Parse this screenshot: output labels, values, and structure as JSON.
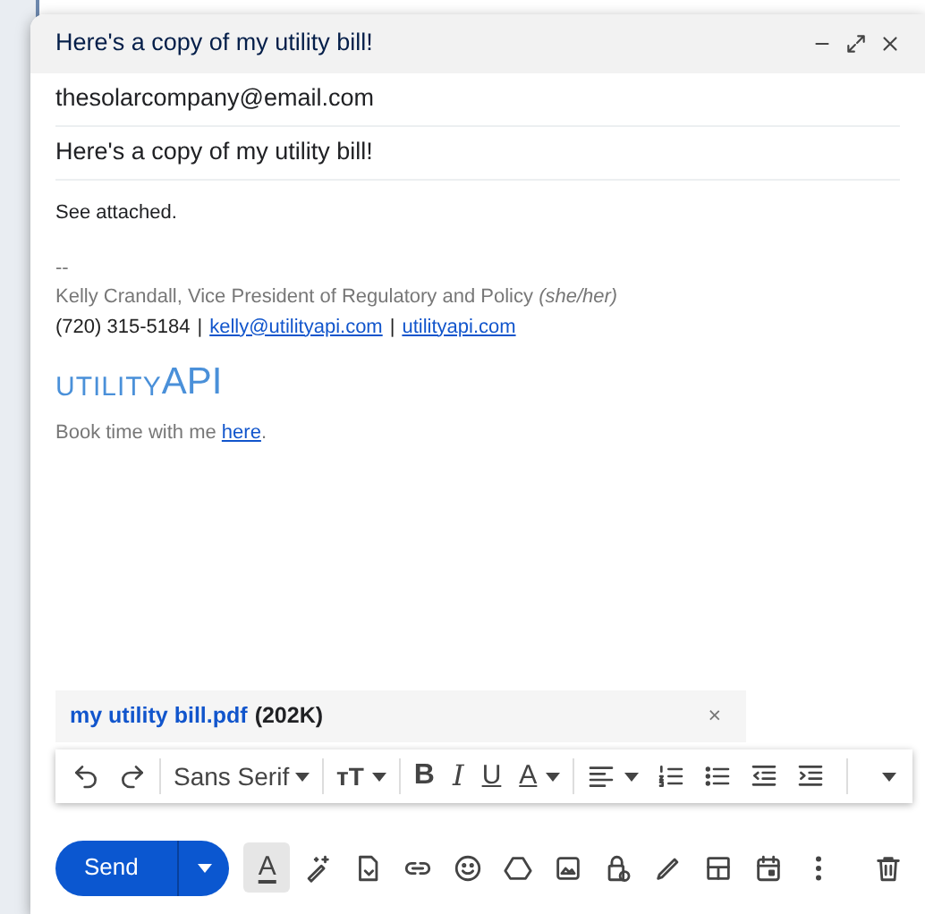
{
  "window": {
    "title": "Here's a copy of my utility bill!",
    "controls": [
      {
        "kind": "minimize"
      },
      {
        "kind": "expand"
      },
      {
        "kind": "close"
      }
    ]
  },
  "to": {
    "value": "thesolarcompany@email.com"
  },
  "subject": {
    "value": "Here's a copy of my utility bill!"
  },
  "body": {
    "text": "See attached.",
    "signature": {
      "separator": "--",
      "name_line": "Kelly Crandall, Vice President of Regulatory and Policy *(she/her)*",
      "phone": "(720) 315-5184",
      "divider": "|",
      "email": "kelly@utilityapi.com",
      "site": "utilityapi.com",
      "logo": {
        "prefix": "UTILITY",
        "suffix": "API"
      },
      "booking": {
        "text": "Book time with me ",
        "link": "here",
        "end": "."
      }
    }
  },
  "attachment": {
    "name": "my utility bill.pdf",
    "size": "(202K)",
    "remove": "×"
  },
  "format_toolbar": [
    {
      "kind": "undo"
    },
    {
      "kind": "redo"
    },
    {
      "kind": "font",
      "label": "Sans Serif"
    },
    {
      "kind": "size",
      "label": "тT"
    },
    {
      "kind": "bold",
      "label": "B"
    },
    {
      "kind": "italic",
      "label": "I"
    },
    {
      "kind": "underline",
      "label": "U"
    },
    {
      "kind": "color",
      "label": "A"
    },
    {
      "kind": "align"
    },
    {
      "kind": "numbered"
    },
    {
      "kind": "bulleted"
    },
    {
      "kind": "outdent"
    },
    {
      "kind": "indent"
    },
    {
      "kind": "more"
    }
  ],
  "send": {
    "label": "Send"
  },
  "bottom_toolbar": [
    {
      "kind": "formatting",
      "label": "A",
      "selected": true
    },
    {
      "kind": "ai-write",
      "selected": false
    },
    {
      "kind": "attach-doc",
      "selected": false
    },
    {
      "kind": "link",
      "selected": false
    },
    {
      "kind": "emoji",
      "selected": false
    },
    {
      "kind": "drive",
      "selected": false
    },
    {
      "kind": "photo",
      "selected": false
    },
    {
      "kind": "confidential",
      "selected": false
    },
    {
      "kind": "signature",
      "selected": false
    },
    {
      "kind": "layout",
      "selected": false
    },
    {
      "kind": "calendar",
      "selected": false
    },
    {
      "kind": "more",
      "selected": false
    }
  ],
  "discard": {
    "kind": "trash"
  }
}
